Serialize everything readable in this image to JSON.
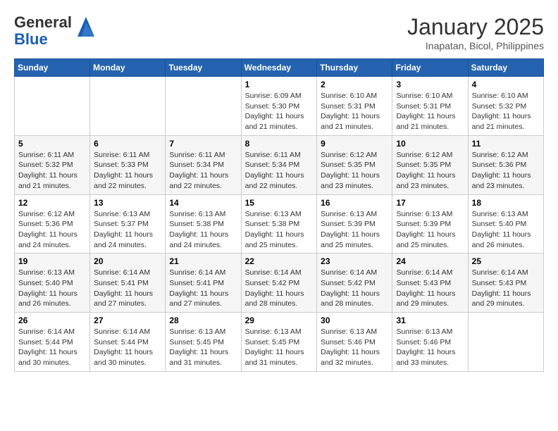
{
  "header": {
    "logo_general": "General",
    "logo_blue": "Blue",
    "month_title": "January 2025",
    "subtitle": "Inapatan, Bicol, Philippines"
  },
  "weekdays": [
    "Sunday",
    "Monday",
    "Tuesday",
    "Wednesday",
    "Thursday",
    "Friday",
    "Saturday"
  ],
  "weeks": [
    [
      {
        "day": "",
        "sunrise": "",
        "sunset": "",
        "daylight": ""
      },
      {
        "day": "",
        "sunrise": "",
        "sunset": "",
        "daylight": ""
      },
      {
        "day": "",
        "sunrise": "",
        "sunset": "",
        "daylight": ""
      },
      {
        "day": "1",
        "sunrise": "Sunrise: 6:09 AM",
        "sunset": "Sunset: 5:30 PM",
        "daylight": "Daylight: 11 hours and 21 minutes."
      },
      {
        "day": "2",
        "sunrise": "Sunrise: 6:10 AM",
        "sunset": "Sunset: 5:31 PM",
        "daylight": "Daylight: 11 hours and 21 minutes."
      },
      {
        "day": "3",
        "sunrise": "Sunrise: 6:10 AM",
        "sunset": "Sunset: 5:31 PM",
        "daylight": "Daylight: 11 hours and 21 minutes."
      },
      {
        "day": "4",
        "sunrise": "Sunrise: 6:10 AM",
        "sunset": "Sunset: 5:32 PM",
        "daylight": "Daylight: 11 hours and 21 minutes."
      }
    ],
    [
      {
        "day": "5",
        "sunrise": "Sunrise: 6:11 AM",
        "sunset": "Sunset: 5:32 PM",
        "daylight": "Daylight: 11 hours and 21 minutes."
      },
      {
        "day": "6",
        "sunrise": "Sunrise: 6:11 AM",
        "sunset": "Sunset: 5:33 PM",
        "daylight": "Daylight: 11 hours and 22 minutes."
      },
      {
        "day": "7",
        "sunrise": "Sunrise: 6:11 AM",
        "sunset": "Sunset: 5:34 PM",
        "daylight": "Daylight: 11 hours and 22 minutes."
      },
      {
        "day": "8",
        "sunrise": "Sunrise: 6:11 AM",
        "sunset": "Sunset: 5:34 PM",
        "daylight": "Daylight: 11 hours and 22 minutes."
      },
      {
        "day": "9",
        "sunrise": "Sunrise: 6:12 AM",
        "sunset": "Sunset: 5:35 PM",
        "daylight": "Daylight: 11 hours and 23 minutes."
      },
      {
        "day": "10",
        "sunrise": "Sunrise: 6:12 AM",
        "sunset": "Sunset: 5:35 PM",
        "daylight": "Daylight: 11 hours and 23 minutes."
      },
      {
        "day": "11",
        "sunrise": "Sunrise: 6:12 AM",
        "sunset": "Sunset: 5:36 PM",
        "daylight": "Daylight: 11 hours and 23 minutes."
      }
    ],
    [
      {
        "day": "12",
        "sunrise": "Sunrise: 6:12 AM",
        "sunset": "Sunset: 5:36 PM",
        "daylight": "Daylight: 11 hours and 24 minutes."
      },
      {
        "day": "13",
        "sunrise": "Sunrise: 6:13 AM",
        "sunset": "Sunset: 5:37 PM",
        "daylight": "Daylight: 11 hours and 24 minutes."
      },
      {
        "day": "14",
        "sunrise": "Sunrise: 6:13 AM",
        "sunset": "Sunset: 5:38 PM",
        "daylight": "Daylight: 11 hours and 24 minutes."
      },
      {
        "day": "15",
        "sunrise": "Sunrise: 6:13 AM",
        "sunset": "Sunset: 5:38 PM",
        "daylight": "Daylight: 11 hours and 25 minutes."
      },
      {
        "day": "16",
        "sunrise": "Sunrise: 6:13 AM",
        "sunset": "Sunset: 5:39 PM",
        "daylight": "Daylight: 11 hours and 25 minutes."
      },
      {
        "day": "17",
        "sunrise": "Sunrise: 6:13 AM",
        "sunset": "Sunset: 5:39 PM",
        "daylight": "Daylight: 11 hours and 25 minutes."
      },
      {
        "day": "18",
        "sunrise": "Sunrise: 6:13 AM",
        "sunset": "Sunset: 5:40 PM",
        "daylight": "Daylight: 11 hours and 26 minutes."
      }
    ],
    [
      {
        "day": "19",
        "sunrise": "Sunrise: 6:13 AM",
        "sunset": "Sunset: 5:40 PM",
        "daylight": "Daylight: 11 hours and 26 minutes."
      },
      {
        "day": "20",
        "sunrise": "Sunrise: 6:14 AM",
        "sunset": "Sunset: 5:41 PM",
        "daylight": "Daylight: 11 hours and 27 minutes."
      },
      {
        "day": "21",
        "sunrise": "Sunrise: 6:14 AM",
        "sunset": "Sunset: 5:41 PM",
        "daylight": "Daylight: 11 hours and 27 minutes."
      },
      {
        "day": "22",
        "sunrise": "Sunrise: 6:14 AM",
        "sunset": "Sunset: 5:42 PM",
        "daylight": "Daylight: 11 hours and 28 minutes."
      },
      {
        "day": "23",
        "sunrise": "Sunrise: 6:14 AM",
        "sunset": "Sunset: 5:42 PM",
        "daylight": "Daylight: 11 hours and 28 minutes."
      },
      {
        "day": "24",
        "sunrise": "Sunrise: 6:14 AM",
        "sunset": "Sunset: 5:43 PM",
        "daylight": "Daylight: 11 hours and 29 minutes."
      },
      {
        "day": "25",
        "sunrise": "Sunrise: 6:14 AM",
        "sunset": "Sunset: 5:43 PM",
        "daylight": "Daylight: 11 hours and 29 minutes."
      }
    ],
    [
      {
        "day": "26",
        "sunrise": "Sunrise: 6:14 AM",
        "sunset": "Sunset: 5:44 PM",
        "daylight": "Daylight: 11 hours and 30 minutes."
      },
      {
        "day": "27",
        "sunrise": "Sunrise: 6:14 AM",
        "sunset": "Sunset: 5:44 PM",
        "daylight": "Daylight: 11 hours and 30 minutes."
      },
      {
        "day": "28",
        "sunrise": "Sunrise: 6:13 AM",
        "sunset": "Sunset: 5:45 PM",
        "daylight": "Daylight: 11 hours and 31 minutes."
      },
      {
        "day": "29",
        "sunrise": "Sunrise: 6:13 AM",
        "sunset": "Sunset: 5:45 PM",
        "daylight": "Daylight: 11 hours and 31 minutes."
      },
      {
        "day": "30",
        "sunrise": "Sunrise: 6:13 AM",
        "sunset": "Sunset: 5:46 PM",
        "daylight": "Daylight: 11 hours and 32 minutes."
      },
      {
        "day": "31",
        "sunrise": "Sunrise: 6:13 AM",
        "sunset": "Sunset: 5:46 PM",
        "daylight": "Daylight: 11 hours and 33 minutes."
      },
      {
        "day": "",
        "sunrise": "",
        "sunset": "",
        "daylight": ""
      }
    ]
  ]
}
